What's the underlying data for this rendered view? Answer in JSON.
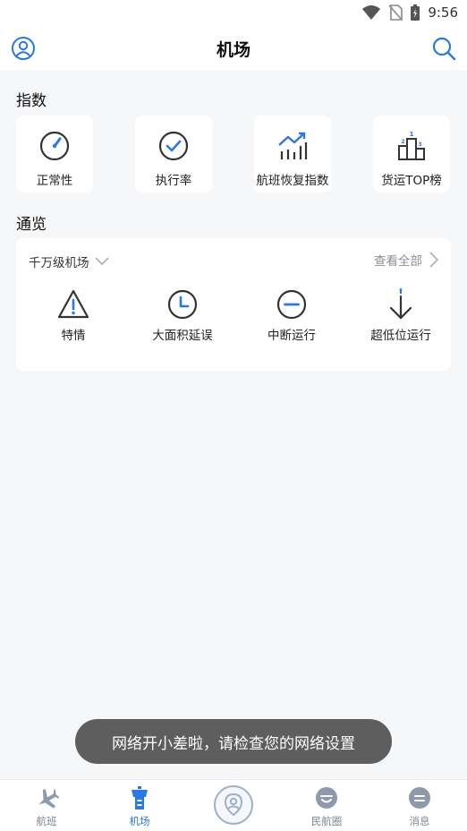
{
  "status_bar": {
    "time": "9:56"
  },
  "header": {
    "title": "机场"
  },
  "index_section": {
    "title": "指数",
    "cards": [
      {
        "label": "正常性",
        "icon": "gauge-icon"
      },
      {
        "label": "执行率",
        "icon": "check-circle-icon"
      },
      {
        "label": "航班恢复指数",
        "icon": "trend-chart-icon"
      },
      {
        "label": "货运TOP榜",
        "icon": "podium-icon"
      }
    ]
  },
  "overview_section": {
    "title": "通览",
    "filter": "千万级机场",
    "view_all": "查看全部",
    "items": [
      {
        "label": "特情",
        "icon": "warning-icon"
      },
      {
        "label": "大面积延误",
        "icon": "clock-icon"
      },
      {
        "label": "中断运行",
        "icon": "minus-circle-icon"
      },
      {
        "label": "超低位运行",
        "icon": "arrow-down-icon"
      }
    ]
  },
  "toast": {
    "message": "网络开小差啦，请检查您的网络设置"
  },
  "bottom_nav": {
    "items": [
      {
        "label": "航班",
        "icon": "airplane-icon",
        "active": false
      },
      {
        "label": "机场",
        "icon": "control-tower-icon",
        "active": true
      },
      {
        "label": "",
        "icon": "location-person-icon",
        "active": false
      },
      {
        "label": "民航圈",
        "icon": "smile-icon",
        "active": false
      },
      {
        "label": "消息",
        "icon": "message-icon",
        "active": false
      }
    ]
  },
  "colors": {
    "accent": "#2a77e8",
    "icon_dark": "#333333",
    "inactive": "#9db0c9"
  }
}
